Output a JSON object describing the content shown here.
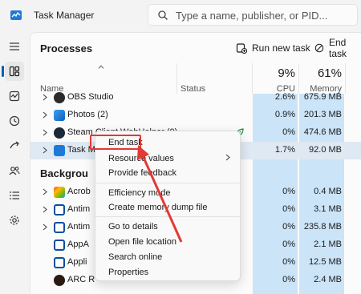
{
  "window": {
    "title": "Task Manager"
  },
  "search": {
    "placeholder": "Type a name, publisher, or PID..."
  },
  "toolbar": {
    "page_title": "Processes",
    "run_new_task": "Run new task",
    "end_task": "End task"
  },
  "columns": {
    "name": "Name",
    "status": "Status",
    "cpu_pct": "9%",
    "cpu_label": "CPU",
    "mem_pct": "61%",
    "mem_label": "Memory"
  },
  "apps": [
    {
      "name": "OBS Studio",
      "cpu": "2.6%",
      "mem": "675.9 MB"
    },
    {
      "name": "Photos (2)",
      "cpu": "0.9%",
      "mem": "201.3 MB"
    },
    {
      "name": "Steam Client WebHelper (9)",
      "cpu": "0%",
      "mem": "474.6 MB"
    },
    {
      "name": "Task M",
      "cpu": "1.7%",
      "mem": "92.0 MB"
    }
  ],
  "background_group": "Backgrou",
  "background": [
    {
      "name": "Acrob",
      "cpu": "0%",
      "mem": "0.4 MB"
    },
    {
      "name": "Antim",
      "cpu": "0%",
      "mem": "3.1 MB"
    },
    {
      "name": "Antim",
      "cpu": "0%",
      "mem": "235.8 MB"
    },
    {
      "name": "AppA",
      "cpu": "0%",
      "mem": "2.1 MB"
    },
    {
      "name": "Appli",
      "cpu": "0%",
      "mem": "12.5 MB"
    },
    {
      "name": "ARC R",
      "cpu": "0%",
      "mem": "2.4 MB"
    }
  ],
  "context_menu": {
    "end_task": "End task",
    "resource_values": "Resource values",
    "provide_feedback": "Provide feedback",
    "efficiency_mode": "Efficiency mode",
    "create_dump": "Create memory dump file",
    "go_to_details": "Go to details",
    "open_file_location": "Open file location",
    "search_online": "Search online",
    "properties": "Properties"
  },
  "colors": {
    "accent": "#005fb8",
    "highlight": "#e23a34",
    "metric_bg": "#cbe4f8"
  }
}
